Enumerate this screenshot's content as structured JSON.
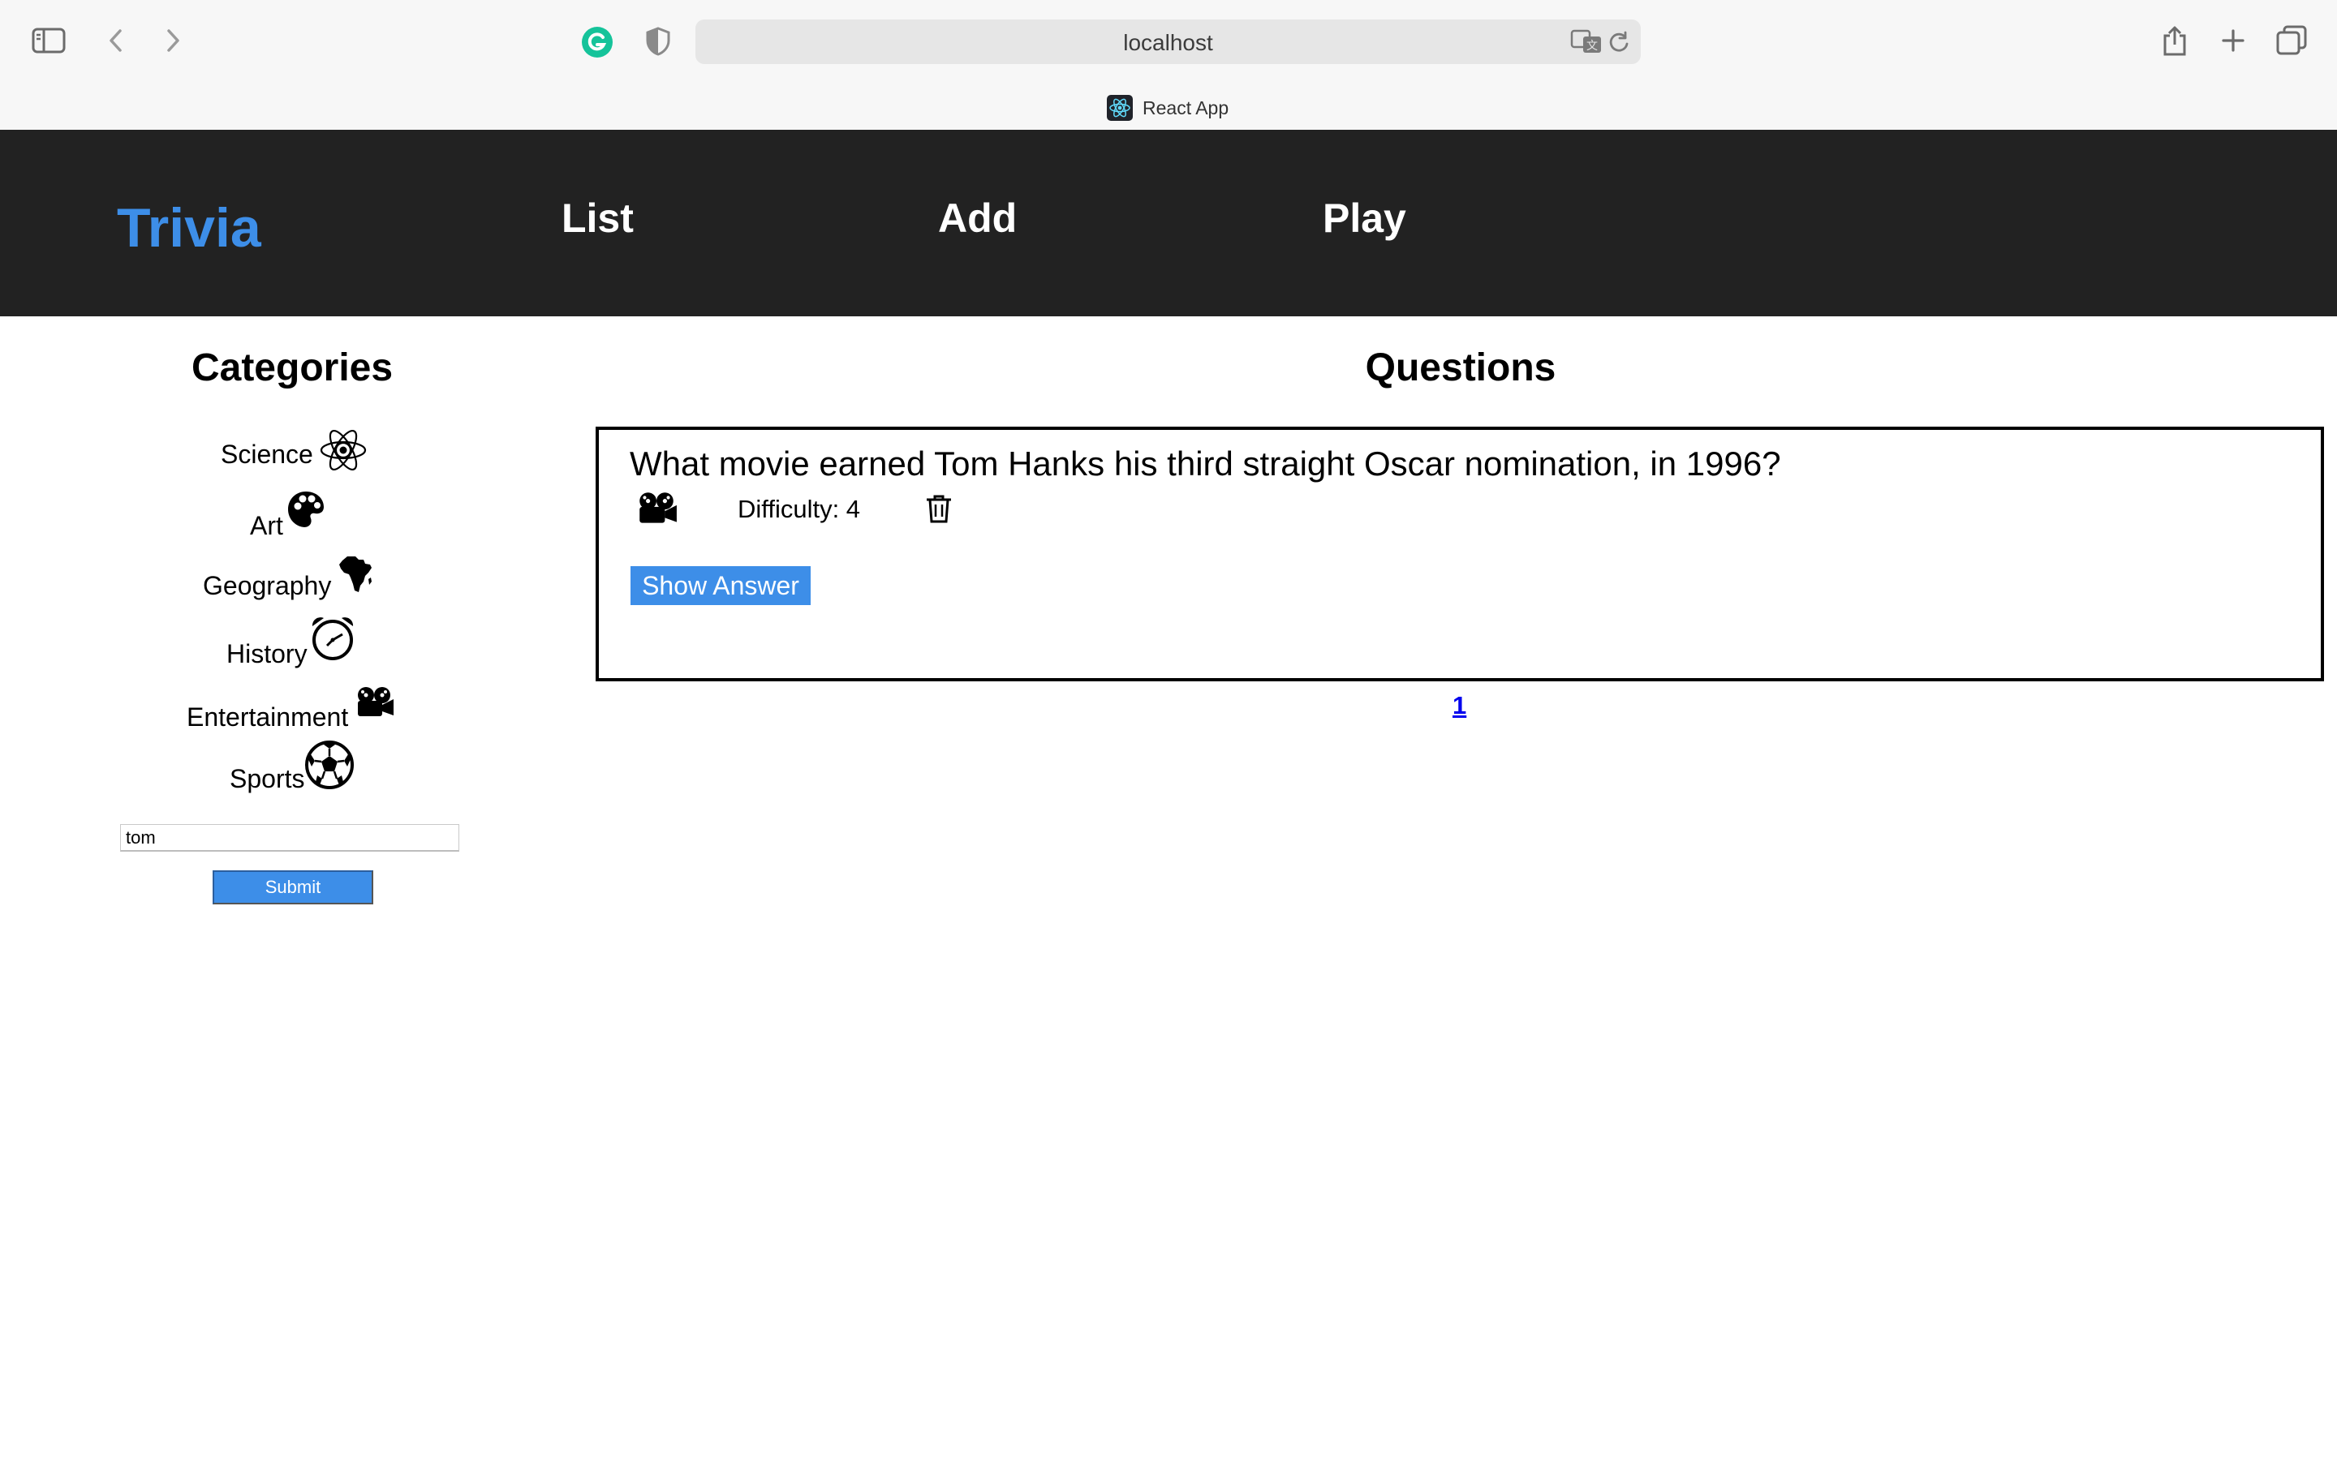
{
  "browser": {
    "url": "localhost",
    "tab_title": "React App",
    "icons": [
      "sidebar-toggle-icon",
      "back-icon",
      "forward-icon",
      "grammarly-icon",
      "privacy-shield-icon",
      "translate-icon",
      "reload-icon",
      "share-icon",
      "new-tab-icon",
      "tab-overview-icon"
    ]
  },
  "header": {
    "brand": "Trivia",
    "nav": [
      "List",
      "Add",
      "Play"
    ]
  },
  "categories": {
    "title": "Categories",
    "items": [
      {
        "label": "Science",
        "icon": "atom-icon"
      },
      {
        "label": "Art",
        "icon": "palette-icon"
      },
      {
        "label": "Geography",
        "icon": "africa-icon"
      },
      {
        "label": "History",
        "icon": "alarm-clock-icon"
      },
      {
        "label": "Entertainment",
        "icon": "film-projector-icon"
      },
      {
        "label": "Sports",
        "icon": "soccer-ball-icon"
      }
    ]
  },
  "search": {
    "value": "tom",
    "submit_label": "Submit"
  },
  "questions": {
    "title": "Questions",
    "items": [
      {
        "question": "What movie earned Tom Hanks his third straight Oscar nomination, in 1996?",
        "category_icon": "film-projector-icon",
        "difficulty": "Difficulty: 4",
        "show_answer_label": "Show Answer"
      }
    ],
    "pages": [
      "1"
    ]
  },
  "colors": {
    "header_bg": "#222222",
    "brand": "#3d8ee8",
    "button": "#3d8ee8",
    "link": "#0000ee"
  }
}
